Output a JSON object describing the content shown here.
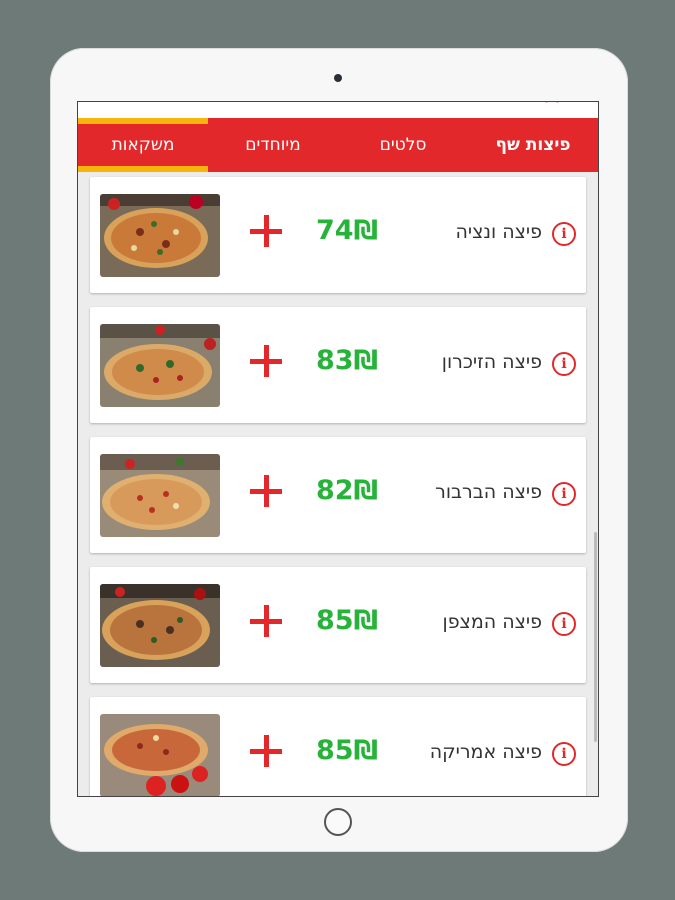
{
  "tabs": [
    {
      "label": "משקאות"
    },
    {
      "label": "מיוחדים"
    },
    {
      "label": "סלטים"
    },
    {
      "label": "פיצות שף",
      "active": true
    }
  ],
  "items": [
    {
      "name": "פיצה ונציה",
      "price": "74₪"
    },
    {
      "name": "פיצה הזיכרון",
      "price": "83₪"
    },
    {
      "name": "פיצה הברבור",
      "price": "82₪"
    },
    {
      "name": "פיצה המצפן",
      "price": "85₪"
    },
    {
      "name": "פיצה אמריקה",
      "price": "85₪"
    }
  ],
  "icons": {
    "add": "plus-icon",
    "info": "info-icon"
  },
  "colors": {
    "accent": "#e2282a",
    "price": "#27b33a",
    "tab_highlight": "#f7b40c"
  }
}
